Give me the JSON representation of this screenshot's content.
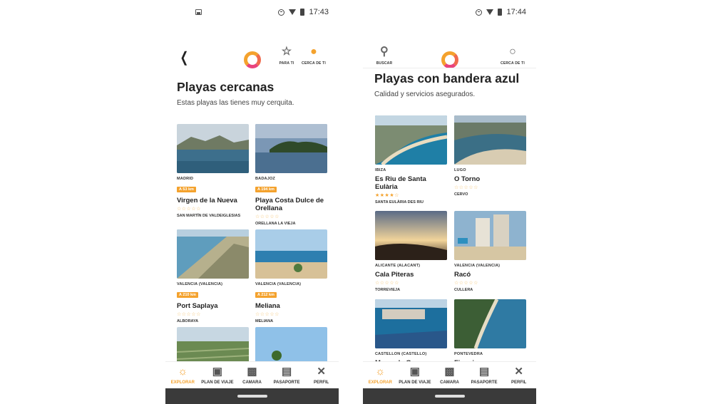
{
  "screens": [
    {
      "time": "17:43",
      "nav": {
        "para_ti": "PARA TI",
        "cerca_de_ti": "CERCA DE TI"
      },
      "title": "Playas cercanas",
      "subtitle": "Estas playas las tienes muy cerquita.",
      "cards": [
        {
          "region": "MADRID",
          "distance": "A 53 km",
          "name": "Virgen de la Nueva",
          "stars": "☆☆☆☆☆",
          "town": "SAN MARTÍN DE VALDEIGLESIAS"
        },
        {
          "region": "BADAJOZ",
          "distance": "A 194 km",
          "name": "Playa Costa Dulce de Orellana",
          "stars": "☆☆☆☆☆",
          "town": "ORELLANA LA VIEJA"
        },
        {
          "region": "VALENCIA (VALENCIA)",
          "distance": "A 210 km",
          "name": "Port Saplaya",
          "stars": "☆☆☆☆☆",
          "town": "ALBORAYA"
        },
        {
          "region": "VALENCIA (VALENCIA)",
          "distance": "A 212 km",
          "name": "Meliana",
          "stars": "☆☆☆☆☆",
          "town": "MELIANA"
        }
      ]
    },
    {
      "time": "17:44",
      "nav": {
        "buscar": "BUSCAR",
        "cerca_de_ti": "CERCA DE TI"
      },
      "title": "Playas con bandera azul",
      "subtitle": "Calidad y servicios asegurados.",
      "cards": [
        {
          "region": "IBIZA",
          "name": "Es Riu de Santa Eulària",
          "stars": "★★★★☆",
          "town": "SANTA EULÀRIA DES RIU"
        },
        {
          "region": "LUGO",
          "name": "O Torno",
          "stars": "☆☆☆☆☆",
          "town": "CERVO"
        },
        {
          "region": "ALICANTE (ALACANT)",
          "name": "Cala Piteras",
          "stars": "☆☆☆☆☆",
          "town": "TORREVIEJA"
        },
        {
          "region": "VALENCIA (VALENCIA)",
          "name": "Racó",
          "stars": "☆☆☆☆☆",
          "town": "CULLERA"
        },
        {
          "region": "CASTELLON (CASTELLO)",
          "name": "Morro de Gos"
        },
        {
          "region": "PONTEVEDRA",
          "name": "Figueiras"
        }
      ]
    }
  ],
  "tabs": {
    "explorar": "EXPLORAR",
    "plan": "PLAN DE VIAJE",
    "camara": "CAMARA",
    "pasaporte": "PASAPORTE",
    "perfil": "PERFIL"
  },
  "colors": {
    "accent": "#f4a22d",
    "brand_pink": "#e9437d"
  }
}
